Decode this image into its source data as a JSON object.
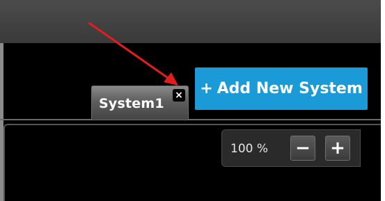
{
  "tabs": [
    {
      "label": "System1",
      "close_icon": "close-icon",
      "close_glyph": "×"
    }
  ],
  "toolbar": {
    "add_button_icon": "+",
    "add_button_label": "Add New System",
    "accent_color": "#1a9bd8"
  },
  "zoom": {
    "level_text": "100 %",
    "zoom_out_glyph": "−",
    "zoom_in_glyph": "+"
  },
  "annotation": {
    "arrow_color": "#e21d1d"
  }
}
